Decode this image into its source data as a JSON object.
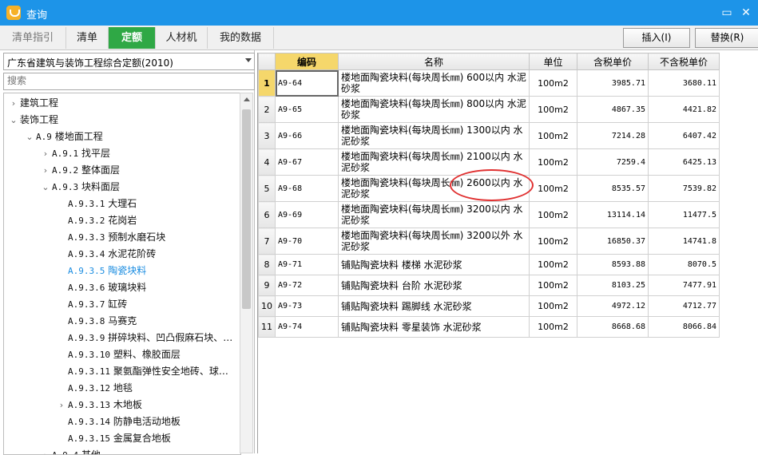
{
  "window": {
    "title": "查询",
    "minimize_glyph": "▭",
    "close_glyph": "✕",
    "accent": "#1d94e8"
  },
  "tabs": [
    {
      "label": "清单指引"
    },
    {
      "label": "清单"
    },
    {
      "label": "定额"
    },
    {
      "label": "人材机"
    },
    {
      "label": "我的数据"
    }
  ],
  "toolbar": {
    "insert_label": "插入(I)",
    "replace_label": "替换(R)"
  },
  "left": {
    "dropdown_value": "广东省建筑与装饰工程综合定额(2010)",
    "search_placeholder": "搜索",
    "tree": [
      {
        "code": "",
        "label": "建筑工程",
        "arrow": "›"
      },
      {
        "code": "",
        "label": "装饰工程",
        "arrow": "⌄"
      },
      {
        "code": "A.9",
        "label": "楼地面工程",
        "arrow": "⌄"
      },
      {
        "code": "A.9.1",
        "label": "找平层",
        "arrow": "›"
      },
      {
        "code": "A.9.2",
        "label": "整体面层",
        "arrow": "›"
      },
      {
        "code": "A.9.3",
        "label": "块料面层",
        "arrow": "⌄"
      },
      {
        "code": "A.9.3.1",
        "label": "大理石",
        "arrow": ""
      },
      {
        "code": "A.9.3.2",
        "label": "花岗岩",
        "arrow": ""
      },
      {
        "code": "A.9.3.3",
        "label": "预制水磨石块",
        "arrow": ""
      },
      {
        "code": "A.9.3.4",
        "label": "水泥花阶砖",
        "arrow": ""
      },
      {
        "code": "A.9.3.5",
        "label": "陶瓷块料",
        "arrow": ""
      },
      {
        "code": "A.9.3.6",
        "label": "玻璃块料",
        "arrow": ""
      },
      {
        "code": "A.9.3.7",
        "label": "缸砖",
        "arrow": ""
      },
      {
        "code": "A.9.3.8",
        "label": "马赛克",
        "arrow": ""
      },
      {
        "code": "A.9.3.9",
        "label": "拼碎块料、凹凸假麻石块、…",
        "arrow": ""
      },
      {
        "code": "A.9.3.10",
        "label": "塑料、橡胶面层",
        "arrow": ""
      },
      {
        "code": "A.9.3.11",
        "label": "聚氨酯弹性安全地砖、球…",
        "arrow": ""
      },
      {
        "code": "A.9.3.12",
        "label": "地毯",
        "arrow": ""
      },
      {
        "code": "A.9.3.13",
        "label": "木地板",
        "arrow": "›"
      },
      {
        "code": "A.9.3.14",
        "label": "防静电活动地板",
        "arrow": ""
      },
      {
        "code": "A.9.3.15",
        "label": "金属复合地板",
        "arrow": ""
      },
      {
        "code": "A.9.4",
        "label": "其他",
        "arrow": "›"
      }
    ],
    "selected_code": "A.9.3.5"
  },
  "grid": {
    "headers": {
      "code": "编码",
      "name": "名称",
      "unit": "单位",
      "tax_price": "含税单价",
      "no_tax_price": "不含税单价"
    },
    "rows": [
      {
        "n": "1",
        "code": "A9-64",
        "name": "楼地面陶瓷块料(每块周长㎜) 600以内 水泥砂浆",
        "unit": "100m2",
        "tax": "3985.71",
        "notax": "3680.11"
      },
      {
        "n": "2",
        "code": "A9-65",
        "name": "楼地面陶瓷块料(每块周长㎜) 800以内 水泥砂浆",
        "unit": "100m2",
        "tax": "4867.35",
        "notax": "4421.82"
      },
      {
        "n": "3",
        "code": "A9-66",
        "name": "楼地面陶瓷块料(每块周长㎜) 1300以内 水泥砂浆",
        "unit": "100m2",
        "tax": "7214.28",
        "notax": "6407.42"
      },
      {
        "n": "4",
        "code": "A9-67",
        "name": "楼地面陶瓷块料(每块周长㎜) 2100以内 水泥砂浆",
        "unit": "100m2",
        "tax": "7259.4",
        "notax": "6425.13"
      },
      {
        "n": "5",
        "code": "A9-68",
        "name": "楼地面陶瓷块料(每块周长㎜) 2600以内 水泥砂浆",
        "unit": "100m2",
        "tax": "8535.57",
        "notax": "7539.82"
      },
      {
        "n": "6",
        "code": "A9-69",
        "name": "楼地面陶瓷块料(每块周长㎜) 3200以内 水泥砂浆",
        "unit": "100m2",
        "tax": "13114.14",
        "notax": "11477.5"
      },
      {
        "n": "7",
        "code": "A9-70",
        "name": "楼地面陶瓷块料(每块周长㎜) 3200以外 水泥砂浆",
        "unit": "100m2",
        "tax": "16850.37",
        "notax": "14741.8"
      },
      {
        "n": "8",
        "code": "A9-71",
        "name": "铺贴陶瓷块料 楼梯 水泥砂浆",
        "unit": "100m2",
        "tax": "8593.88",
        "notax": "8070.5"
      },
      {
        "n": "9",
        "code": "A9-72",
        "name": "铺贴陶瓷块料 台阶 水泥砂浆",
        "unit": "100m2",
        "tax": "8103.25",
        "notax": "7477.91"
      },
      {
        "n": "10",
        "code": "A9-73",
        "name": "铺贴陶瓷块料 踢脚线 水泥砂浆",
        "unit": "100m2",
        "tax": "4972.12",
        "notax": "4712.77"
      },
      {
        "n": "11",
        "code": "A9-74",
        "name": "铺贴陶瓷块料 零星装饰 水泥砂浆",
        "unit": "100m2",
        "tax": "8668.68",
        "notax": "8066.84"
      }
    ],
    "selected_row": "1"
  }
}
